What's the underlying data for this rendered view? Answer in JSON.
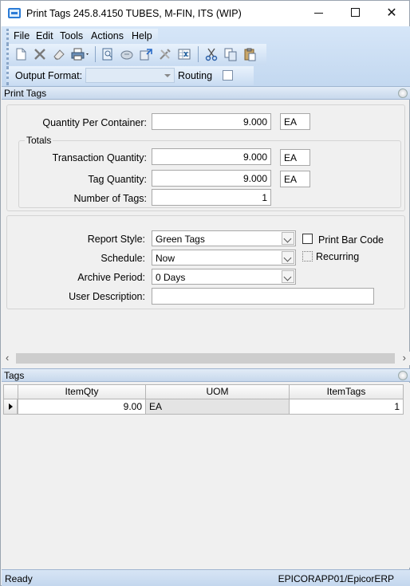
{
  "window": {
    "title": "Print Tags 245.8.4150 TUBES, M-FIN, ITS (WIP)",
    "minimize_glyph": "",
    "close_glyph": "✕"
  },
  "menu": [
    "File",
    "Edit",
    "Tools",
    "Actions",
    "Help"
  ],
  "toolbar_icons": [
    "new-icon",
    "delete-icon",
    "clear-icon",
    "print-icon",
    "print-preview-icon",
    "attach-icon",
    "refresh-icon",
    "tools-icon",
    "excel-icon",
    "cut-icon",
    "copy-icon",
    "paste-icon"
  ],
  "format_bar": {
    "output_format_label": "Output Format:",
    "output_format_value": "",
    "routing_label": "Routing",
    "routing_checked": false
  },
  "print_tags_panel": {
    "header": "Print Tags",
    "qty_per_container_label": "Quantity Per Container:",
    "qty_per_container_value": "9.000",
    "qty_per_container_uom": "EA",
    "totals_title": "Totals",
    "transaction_qty_label": "Transaction Quantity:",
    "transaction_qty_value": "9.000",
    "transaction_qty_uom": "EA",
    "tag_qty_label": "Tag Quantity:",
    "tag_qty_value": "9.000",
    "tag_qty_uom": "EA",
    "num_tags_label": "Number of Tags:",
    "num_tags_value": "1",
    "report_style_label": "Report Style:",
    "report_style_value": "Green Tags",
    "schedule_label": "Schedule:",
    "schedule_value": "Now",
    "archive_period_label": "Archive Period:",
    "archive_period_value": "0 Days",
    "user_description_label": "User Description:",
    "user_description_value": "",
    "print_bar_code_label": "Print Bar Code",
    "print_bar_code_checked": false,
    "recurring_label": "Recurring",
    "recurring_checked": false
  },
  "tags_panel": {
    "header": "Tags",
    "columns": [
      "ItemQty",
      "UOM",
      "ItemTags"
    ],
    "rows": [
      {
        "item_qty": "9.00",
        "uom": "EA",
        "item_tags": "1"
      }
    ]
  },
  "status": {
    "left": "Ready",
    "right": "EPICORAPP01/EpicorERP"
  },
  "colors": {
    "band": "#c9dcf2",
    "panel_header": "#d3e1f1",
    "accent": "#2b7bd6"
  }
}
